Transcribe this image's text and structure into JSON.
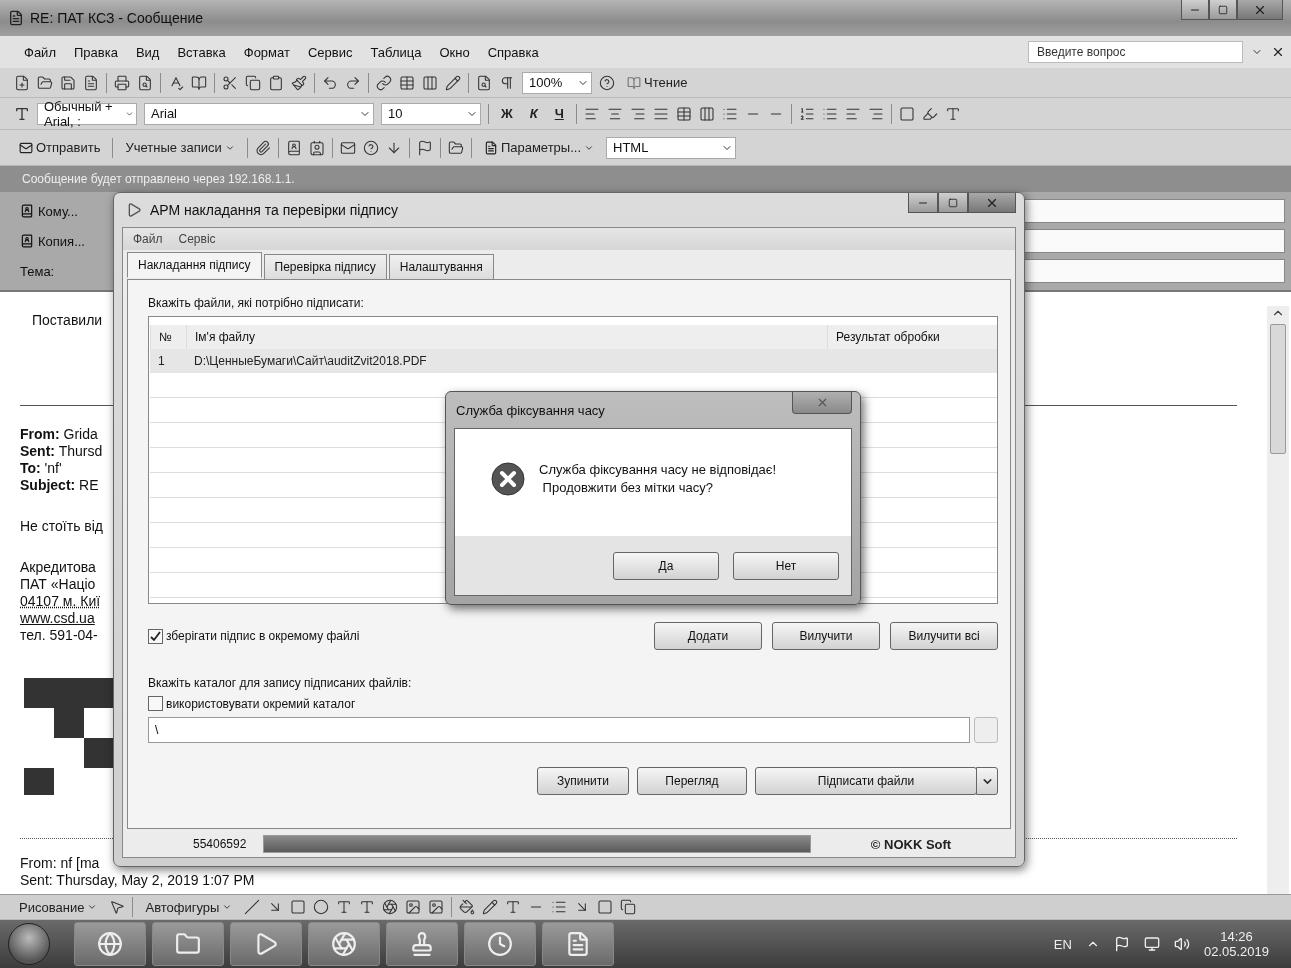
{
  "window": {
    "title": "RE: ПАТ КСЗ - Сообщение"
  },
  "menu": [
    "Файл",
    "Правка",
    "Вид",
    "Вставка",
    "Формат",
    "Сервис",
    "Таблица",
    "Окно",
    "Справка"
  ],
  "help_search": {
    "placeholder": "Введите вопрос"
  },
  "standard_toolbar": {
    "zoom": "100%",
    "reading": "Чтение"
  },
  "formatting_toolbar": {
    "style": "Обычный + Arial, :",
    "font": "Arial",
    "size": "10",
    "bold": "Ж",
    "italic": "К",
    "underline": "Ч"
  },
  "email_toolbar": {
    "send": "Отправить",
    "accounts": "Учетные записи",
    "options": "Параметры...",
    "format": "HTML"
  },
  "info_bar": "Сообщение будет отправлено через 192.168.1.1.",
  "header_fields": [
    {
      "kind": "button",
      "label": "Кому..."
    },
    {
      "kind": "button",
      "label": "Копия..."
    },
    {
      "kind": "label",
      "label": "Тема:"
    }
  ],
  "body": {
    "blocks": [
      {
        "kind": "text",
        "lines": [
          {
            "kind": "plain",
            "text": "Поставили"
          }
        ]
      },
      {
        "kind": "rule"
      },
      {
        "kind": "text",
        "lines": [
          {
            "kind": "plain",
            "text": "**From:** Grida"
          },
          {
            "kind": "plain",
            "text": "**Sent:** Thursd"
          },
          {
            "kind": "plain",
            "text": "**To:** 'nf'"
          },
          {
            "kind": "plain",
            "text": "**Subject:** RE"
          }
        ]
      },
      {
        "kind": "text",
        "lines": [
          {
            "kind": "plain",
            "text": "Не стоїть від"
          }
        ]
      },
      {
        "kind": "text",
        "lines": [
          {
            "kind": "plain",
            "text": "Акредитова"
          },
          {
            "kind": "plain",
            "text": "ПАТ «Націо"
          },
          {
            "kind": "underlined",
            "text": "04107 м. Киї"
          },
          {
            "kind": "link",
            "text": "www.csd.ua"
          },
          {
            "kind": "plain",
            "text": "тел. 591-04-"
          }
        ]
      },
      {
        "kind": "logo"
      },
      {
        "kind": "dotted_rule"
      },
      {
        "kind": "text",
        "lines": [
          {
            "kind": "plain",
            "text": "From: nf [ma"
          },
          {
            "kind": "plain",
            "text": "Sent: Thursday, May 2, 2019 1:07 PM"
          }
        ]
      }
    ]
  },
  "signing_app": {
    "title": "АРМ накладання та перевірки підпису",
    "menu": [
      "Файл",
      "Сервіс"
    ],
    "tabs": [
      {
        "label": "Накладання підпису",
        "selected": true
      },
      {
        "label": "Перевірка підпису",
        "selected": false
      },
      {
        "label": "Налаштування",
        "selected": false
      }
    ],
    "files_label": "Вкажіть файли, які потрібно підписати:",
    "table": {
      "columns": [
        "№",
        "Ім'я файлу",
        "Результат обробки"
      ],
      "rows": [
        {
          "number": "1",
          "file": "D:\\ЦенныеБумаги\\Сайт\\auditZvit2018.PDF",
          "selected": true
        }
      ]
    },
    "save_separately": {
      "label": "зберігати підпис в окремому файлі",
      "checked": true
    },
    "file_buttons": [
      "Додати",
      "Вилучити",
      "Вилучити всі"
    ],
    "folder_label": "Вкажіть каталог для запису підписаних файлів:",
    "separate_folder": {
      "label": "використовувати окремий каталог",
      "checked": false
    },
    "folder_path": "\\",
    "action_buttons": [
      {
        "kind": "plain",
        "label": "Зупинити"
      },
      {
        "kind": "plain",
        "label": "Перегляд"
      },
      {
        "kind": "split",
        "label": "Підписати файли"
      }
    ],
    "status": {
      "code": "55406592",
      "progress": {
        "level": 1
      },
      "vendor": "© NOKK Soft"
    }
  },
  "message_box": {
    "title": "Служба фіксування часу",
    "lines": [
      "Служба фіксування часу не відповідає!",
      " Продовжити без мітки часу?"
    ],
    "buttons": [
      "Да",
      "Нет"
    ]
  },
  "drawing_toolbar": {
    "drawing": "Рисование",
    "autoshapes": "Автофигуры"
  },
  "taskbar": {
    "language": "EN",
    "time": "14:26",
    "date": "02.05.2019"
  }
}
